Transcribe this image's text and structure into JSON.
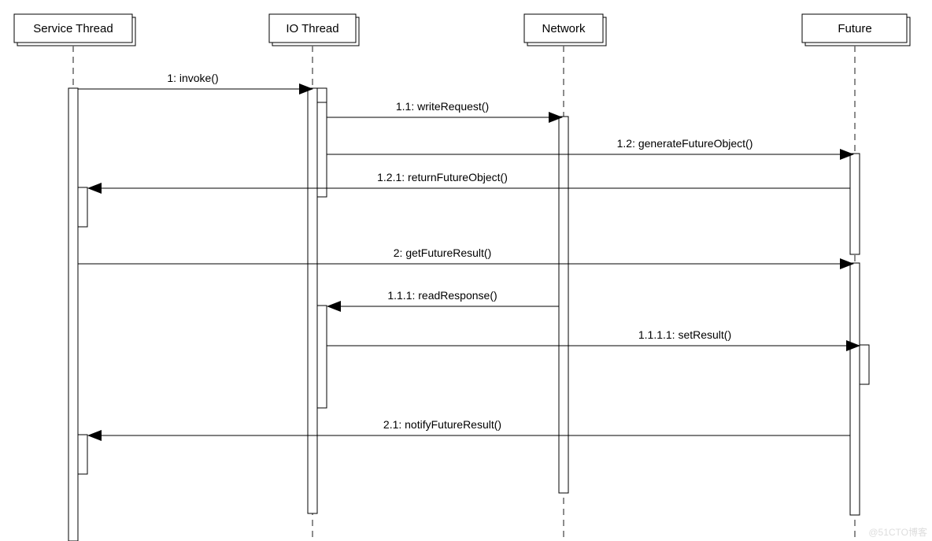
{
  "participants": {
    "p1": "Service Thread",
    "p2": "IO Thread",
    "p3": "Network",
    "p4": "Future"
  },
  "messages": {
    "m1": "1: invoke()",
    "m2": "1.1: writeRequest()",
    "m3": "1.2: generateFutureObject()",
    "m4": "1.2.1: returnFutureObject()",
    "m5": "2: getFutureResult()",
    "m6": "1.1.1: readResponse()",
    "m7": "1.1.1.1: setResult()",
    "m8": "2.1: notifyFutureResult()"
  },
  "watermark": "@51CTO博客"
}
